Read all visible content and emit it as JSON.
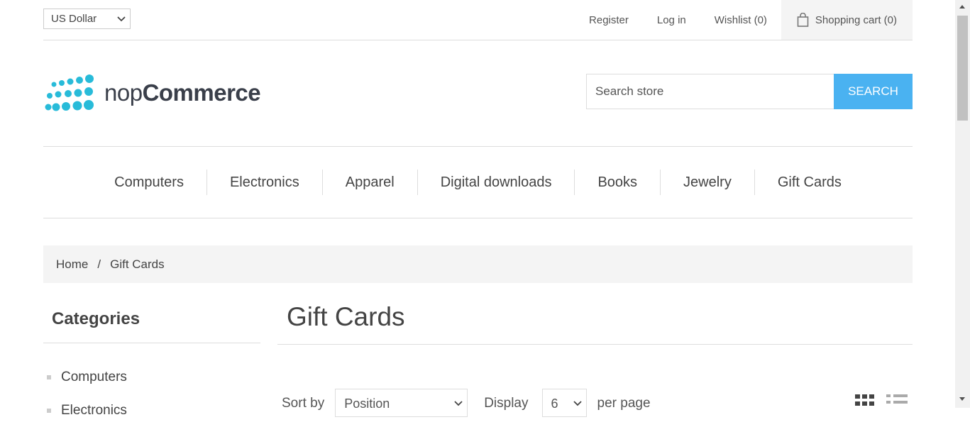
{
  "header": {
    "currency": "US Dollar",
    "links": [
      "Register",
      "Log in",
      "Wishlist (0)"
    ],
    "cart": "Shopping cart (0)"
  },
  "logo": {
    "prefix": "nop",
    "brand": "Commerce",
    "dot_color": "#28bbd9"
  },
  "search": {
    "placeholder": "Search store",
    "button": "SEARCH",
    "button_color": "#4ab2f1"
  },
  "menu": [
    "Computers",
    "Electronics",
    "Apparel",
    "Digital downloads",
    "Books",
    "Jewelry",
    "Gift Cards"
  ],
  "breadcrumb": {
    "home": "Home",
    "separator": "/",
    "current": "Gift Cards"
  },
  "sidebar": {
    "title": "Categories",
    "items": [
      "Computers",
      "Electronics"
    ]
  },
  "main": {
    "title": "Gift Cards",
    "sort_label": "Sort by",
    "sort_value": "Position",
    "display_label": "Display",
    "display_value": "6",
    "per_page": "per page"
  }
}
